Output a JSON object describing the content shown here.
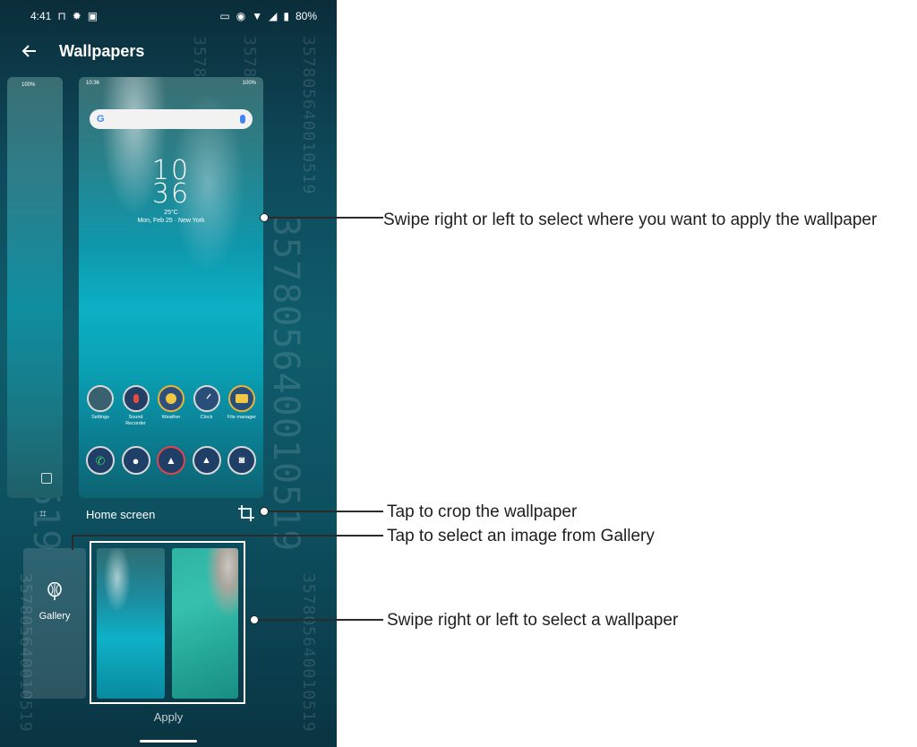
{
  "status_bar": {
    "time": "4:41",
    "battery": "80%",
    "left_icons": [
      "pin-icon",
      "gear-icon",
      "image-icon"
    ],
    "right_icons": [
      "cast-icon",
      "vibrate-icon",
      "wifi-icon",
      "data-icon",
      "signal-icon",
      "battery-icon"
    ]
  },
  "app_bar": {
    "title": "Wallpapers"
  },
  "watermark": {
    "text": "357805640010519"
  },
  "preview": {
    "mini_time": "10:36",
    "mini_battery": "100%",
    "google_logo": "G",
    "clock_h": "10",
    "clock_m": "36",
    "weather": "25°C",
    "date_location": "Mon, Feb 25 · New York",
    "apps_row1": [
      {
        "label": "Settings",
        "icon": "settings-icon",
        "color": "#3a6170"
      },
      {
        "label": "Sound Recorder",
        "icon": "microphone-icon",
        "color": "#c0392b"
      },
      {
        "label": "Weather",
        "icon": "weather-icon",
        "color": "#e1a531"
      },
      {
        "label": "Clock",
        "icon": "clock-icon",
        "color": "#2a4e7a"
      },
      {
        "label": "File manager",
        "icon": "folder-icon",
        "color": "#e2a72e"
      }
    ],
    "dock": [
      {
        "icon": "phone-icon",
        "color": "#2fa84f"
      },
      {
        "icon": "contacts-icon",
        "color": "#2f5fa8"
      },
      {
        "icon": "browser-icon",
        "color": "#c3323a"
      },
      {
        "icon": "gallery-icon",
        "color": "#2f5fa8"
      },
      {
        "icon": "camera-icon",
        "color": "#2f5fa8"
      }
    ]
  },
  "home_screen_label": "Home screen",
  "gallery_label": "Gallery",
  "apply_label": "Apply",
  "callouts": {
    "swipe_apply": "Swipe right or left to select where you want to apply the wallpaper",
    "crop": "Tap to crop the wallpaper",
    "gallery": "Tap to select an image from Gallery",
    "select": "Swipe right or left to select a wallpaper"
  },
  "colors": {
    "accent": "#0fa7bb",
    "callout_line": "#2b2b2b"
  }
}
